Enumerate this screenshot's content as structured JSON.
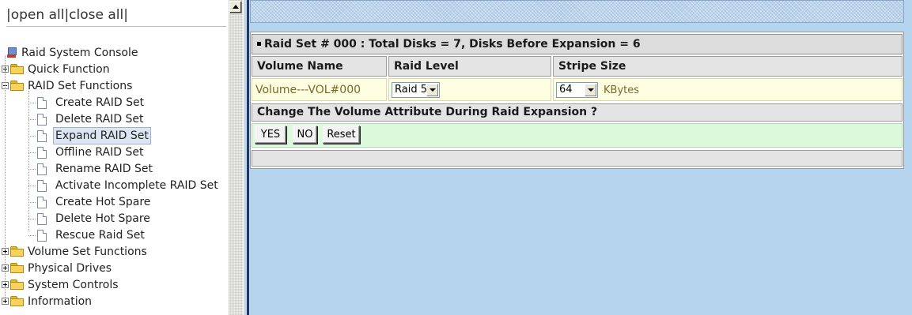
{
  "left": {
    "open_all": "open all",
    "close_all": "close all",
    "sep": "|",
    "tree": {
      "root": "Raid System Console",
      "quick_function": "Quick Function",
      "raid_set_functions": "RAID Set Functions",
      "raid_items": [
        "Create RAID Set",
        "Delete RAID Set",
        "Expand RAID Set",
        "Offline RAID Set",
        "Rename RAID Set",
        "Activate Incomplete RAID Set",
        "Create Hot Spare",
        "Delete Hot Spare",
        "Rescue Raid Set"
      ],
      "volume_set_functions": "Volume Set Functions",
      "physical_drives": "Physical Drives",
      "system_controls": "System Controls",
      "information": "Information"
    }
  },
  "main": {
    "title": "Raid Set # 000 : Total Disks = 7, Disks Before Expansion = 6",
    "columns": {
      "volume_name": "Volume Name",
      "raid_level": "Raid Level",
      "stripe_size": "Stripe Size"
    },
    "row": {
      "volume_name": "Volume---VOL#000",
      "raid_level": "Raid 5",
      "stripe_size": "64",
      "stripe_unit": "KBytes"
    },
    "question": "Change The Volume Attribute During Raid Expansion ?",
    "buttons": {
      "yes": "YES",
      "no": "NO",
      "reset": "Reset"
    }
  },
  "colors": {
    "right_bg": "#b5d5ee",
    "header_gray": "#dcdcdc",
    "row_yellow": "#fdfde0",
    "row_green": "#dcf9dc",
    "selected_item_bg": "#dce6f2",
    "splitter_dark": "#1a3a6e"
  },
  "icons": {
    "root": "raid-console-icon",
    "folder": "folder-icon",
    "document": "document-icon",
    "expander_plus": "plus-box-icon",
    "expander_minus": "minus-box-icon"
  }
}
